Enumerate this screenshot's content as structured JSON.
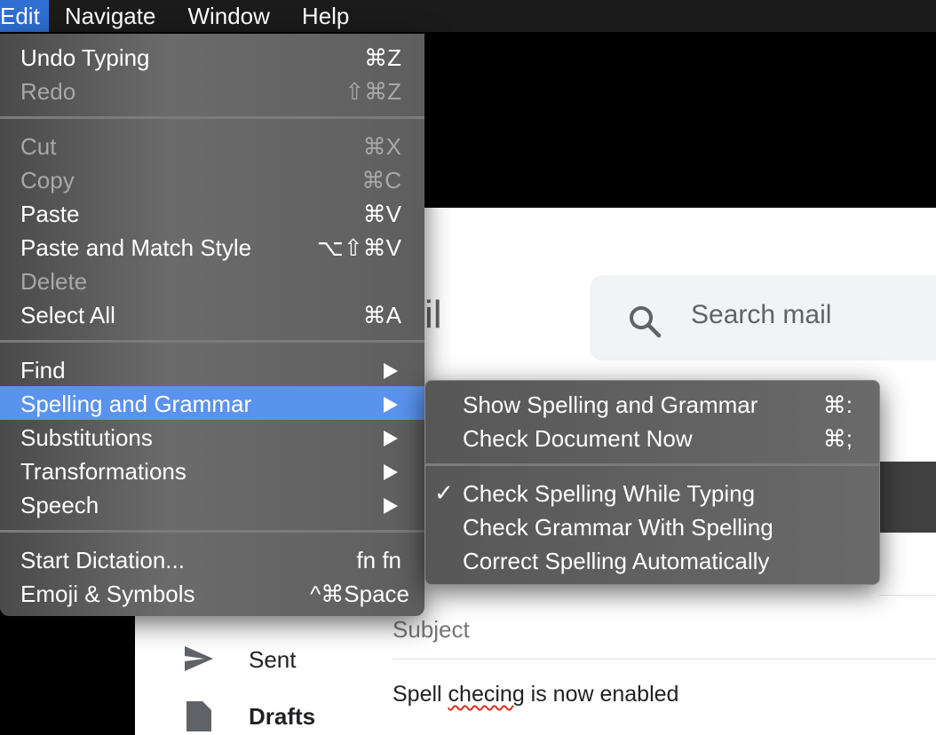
{
  "menubar": {
    "items": [
      "Edit",
      "Navigate",
      "Window",
      "Help"
    ]
  },
  "edit_menu": {
    "undo": {
      "label": "Undo Typing",
      "shortcut": "⌘Z"
    },
    "redo": {
      "label": "Redo",
      "shortcut": "⇧⌘Z"
    },
    "cut": {
      "label": "Cut",
      "shortcut": "⌘X"
    },
    "copy": {
      "label": "Copy",
      "shortcut": "⌘C"
    },
    "paste": {
      "label": "Paste",
      "shortcut": "⌘V"
    },
    "paste_match": {
      "label": "Paste and Match Style",
      "shortcut": "⌥⇧⌘V"
    },
    "delete": {
      "label": "Delete"
    },
    "select_all": {
      "label": "Select All",
      "shortcut": "⌘A"
    },
    "find": {
      "label": "Find"
    },
    "spelling": {
      "label": "Spelling and Grammar"
    },
    "substitutions": {
      "label": "Substitutions"
    },
    "transformations": {
      "label": "Transformations"
    },
    "speech": {
      "label": "Speech"
    },
    "dictation": {
      "label": "Start Dictation...",
      "shortcut": "fn fn"
    },
    "emoji": {
      "label": "Emoji & Symbols",
      "shortcut": "^⌘Space"
    }
  },
  "spelling_submenu": {
    "show": {
      "label": "Show Spelling and Grammar",
      "shortcut": "⌘:"
    },
    "check_now": {
      "label": "Check Document Now",
      "shortcut": "⌘;"
    },
    "check_while_typing": {
      "label": "Check Spelling While Typing",
      "checked": true,
      "check": "✓"
    },
    "check_grammar": {
      "label": "Check Grammar With Spelling"
    },
    "correct_auto": {
      "label": "Correct Spelling Automatically"
    }
  },
  "gmail": {
    "logo_fragment": "il",
    "search_placeholder": "Search mail",
    "nav": {
      "sent": "Sent",
      "drafts": "Drafts"
    },
    "compose": {
      "subject_placeholder": "Subject",
      "body_before": "Spell ",
      "body_error_word": "checing",
      "body_after": " is now enabled"
    }
  },
  "colors": {
    "menu_highlight": "#5a93ee",
    "menubar_active": "#2f6fd1",
    "spell_underline": "#d93025"
  }
}
